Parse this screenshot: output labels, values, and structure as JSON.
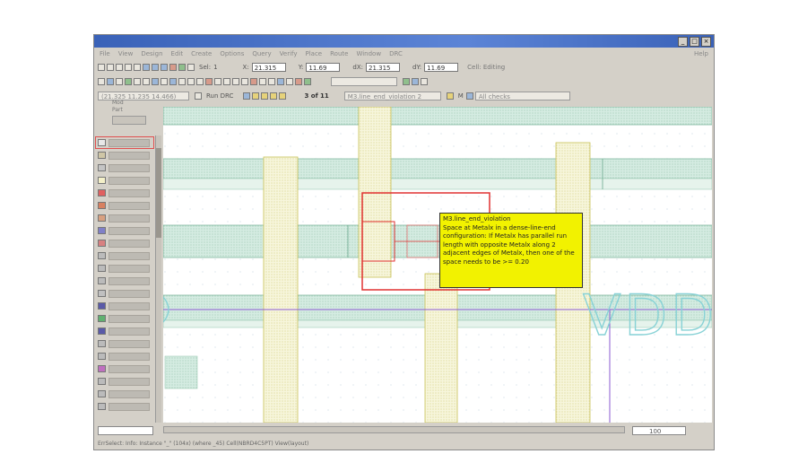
{
  "window": {
    "buttons": [
      "_",
      "□",
      "×"
    ]
  },
  "menu": {
    "items": [
      "File",
      "View",
      "Design",
      "Edit",
      "Create",
      "Options",
      "Query",
      "Verify",
      "Place",
      "Route",
      "Window",
      "DRC"
    ],
    "help": "Help"
  },
  "toolbar1": {
    "sel_label": "Sel:",
    "sel_value": "1",
    "x_label": "X:",
    "x_value": "21.315",
    "y_label": "Y:",
    "y_value": "11.69",
    "dx_label": "dX:",
    "dx_value": "21.315",
    "dy_label": "dY:",
    "dy_value": "11.69",
    "mode": "Cell: Editing"
  },
  "toolbar3": {
    "coords": "(21.325 11.235 14.466)",
    "run_drc": "Run DRC",
    "count": "3 of 11",
    "rule": "M3.line_end_violation 2",
    "layer": "M",
    "checks": "All checks"
  },
  "layers_header": [
    "Mod",
    "Part"
  ],
  "tooltip": {
    "title": "M3.line_end_violation",
    "body": "Space at Metalx in a dense-line-end configuration: If Metalx has parallel run length with opposite Metalx along 2 adjacent edges of Metalx, then one of the space needs to be >= 0.20"
  },
  "label_vdd": "VDD",
  "zoom": "100",
  "status": "ErrSelect: Info: Instance \"_\" (104x) (where _45) Cell(NBRD4C5PT) View(layout)",
  "colors": {
    "highlight": "#e03030",
    "tooltip_bg": "#f2f200",
    "vdd": "#88d2d6",
    "metal_band": "#c7e6d6"
  }
}
